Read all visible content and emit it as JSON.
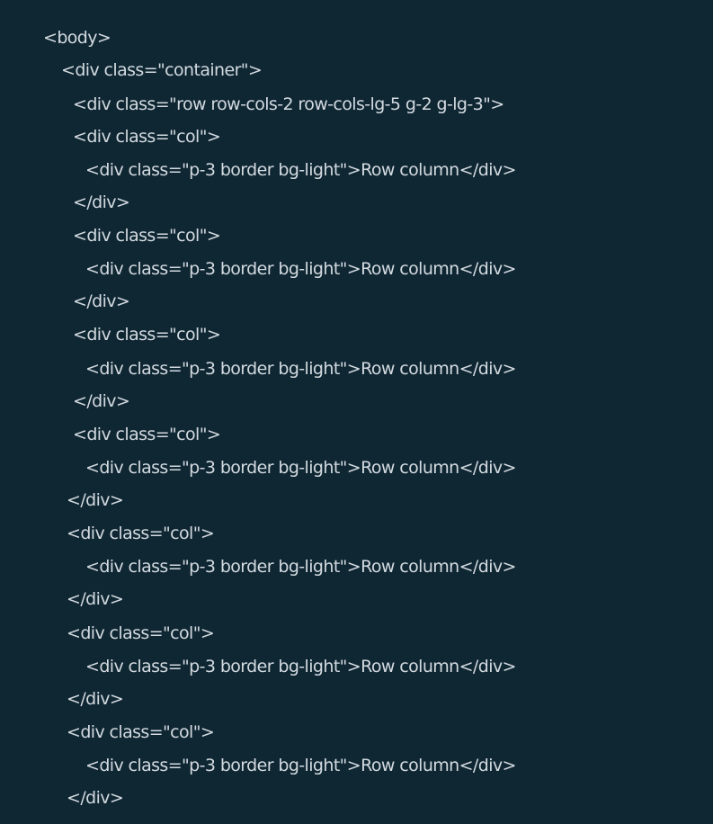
{
  "code_lines": [
    "<body>",
    "<div class=\"container\">",
    "<div class=\"row row-cols-2 row-cols-lg-5 g-2 g-lg-3\">",
    "<div class=\"col\">",
    "<div class=\"p-3 border bg-light\">Row column</div>",
    "</div>",
    "<div class=\"col\">",
    "<div class=\"p-3 border bg-light\">Row column</div>",
    "</div>",
    "<div class=\"col\">",
    "<div class=\"p-3 border bg-light\">Row column</div>",
    "</div>",
    "<div class=\"col\">",
    "<div class=\"p-3 border bg-light\">Row column</div>",
    "</div>",
    "<div class=\"col\">",
    "<div class=\"p-3 border bg-light\">Row column</div>",
    "</div>",
    "<div class=\"col\">",
    "<div class=\"p-3 border bg-light\">Row column</div>",
    "</div>",
    "<div class=\"col\">",
    "<div class=\"p-3 border bg-light\">Row column</div>",
    "</div>"
  ],
  "colors": {
    "background": "#0f2733",
    "text": "#d3dae0"
  }
}
